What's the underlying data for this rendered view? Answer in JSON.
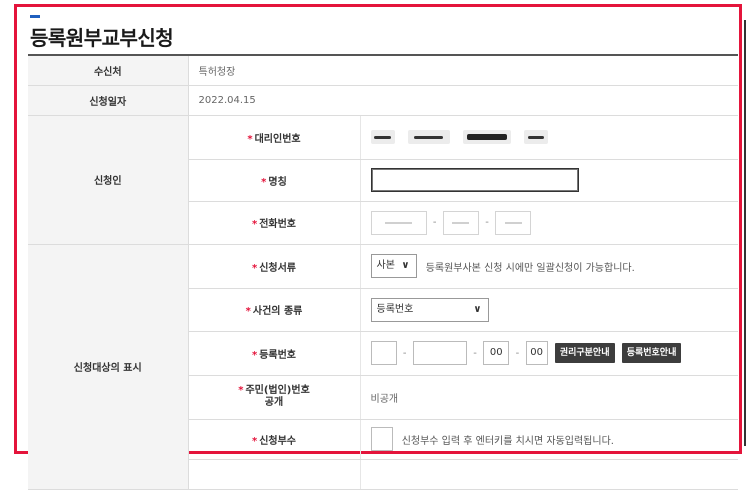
{
  "page": {
    "title": "등록원부교부신청"
  },
  "rows": {
    "recipient": {
      "label": "수신처",
      "value": "특허청장"
    },
    "apply_date": {
      "label": "신청일자",
      "value": "2022.04.15"
    },
    "applicant": {
      "label": "신청인",
      "agent_no": {
        "label": "대리인번호"
      },
      "name": {
        "label": "명칭",
        "value": ""
      },
      "phone": {
        "label": "전화번호"
      }
    },
    "target": {
      "label": "신청대상의 표시",
      "doc_type": {
        "label": "신청서류",
        "selected": "사본",
        "note": "등록원부사본 신청 시에만 일괄신청이 가능합니다."
      },
      "case_type": {
        "label": "사건의 종류",
        "selected": "등록번호"
      },
      "reg_no": {
        "label": "등록번호",
        "part3": "00",
        "part4": "00",
        "btn_rights": "권리구분안내",
        "btn_regno": "등록번호안내"
      },
      "id_disclose": {
        "label_line1": "주민(법인)번호",
        "label_line2": "공개",
        "value": "비공개"
      },
      "copies": {
        "label": "신청부수",
        "note": "신청부수 입력 후 엔터키를 치시면 자동입력됩니다."
      }
    }
  },
  "required_mark": "*",
  "colors": {
    "frame": "#e4143b",
    "accent": "#1f5fbf",
    "required": "#e4143b"
  }
}
